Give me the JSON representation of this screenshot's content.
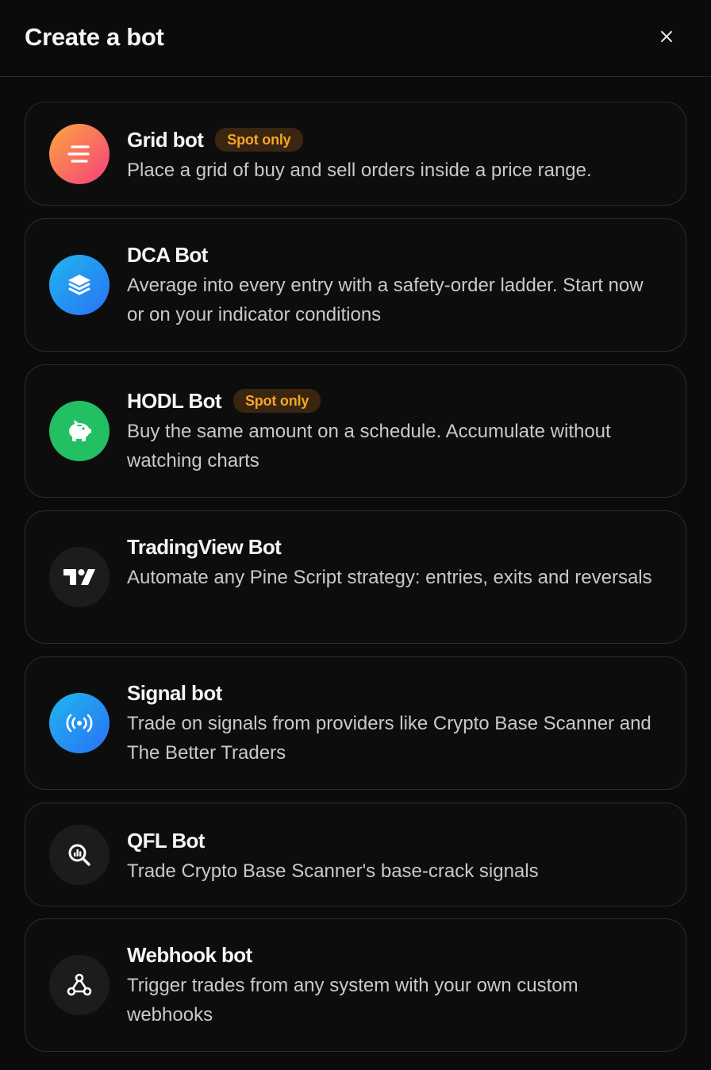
{
  "dialog": {
    "title": "Create a bot",
    "close_icon": "close-icon"
  },
  "bots": [
    {
      "name": "Grid bot",
      "badge": "Spot only",
      "description": "Place a grid of buy and sell orders inside a price range.",
      "icon": "grid-lines-icon",
      "icon_bg": [
        "#ffa63d",
        "#f43f7f"
      ]
    },
    {
      "name": "DCA Bot",
      "badge": "",
      "description": "Average into every entry with a safety-order ladder. Start now or on your indicator conditions",
      "icon": "layers-icon",
      "icon_bg": [
        "#1fb6ee",
        "#2a72f5"
      ]
    },
    {
      "name": "HODL Bot",
      "badge": "Spot only",
      "description": "Buy the same amount on a schedule. Accumulate without watching charts",
      "icon": "piggy-bank-icon",
      "icon_bg": [
        "#23c266",
        "#1fae5a"
      ]
    },
    {
      "name": "TradingView Bot",
      "badge": "",
      "description": "Automate any Pine Script strategy: entries, exits and reversals",
      "icon": "tradingview-logo-icon",
      "icon_bg": [
        "#1c1c1f",
        "#1c1c1f"
      ]
    },
    {
      "name": "Signal bot",
      "badge": "",
      "description": "Trade on signals from providers like Crypto Base Scanner and The Better Traders",
      "icon": "broadcast-signal-icon",
      "icon_bg": [
        "#1fb6ee",
        "#2a72f5"
      ]
    },
    {
      "name": "QFL Bot",
      "badge": "",
      "description": "Trade Crypto Base Scanner's base-crack signals",
      "icon": "chart-search-icon",
      "icon_bg": [
        "#1c1c1f",
        "#1c1c1f"
      ]
    },
    {
      "name": "Webhook bot",
      "badge": "",
      "description": "Trigger trades from any system with your own custom webhooks",
      "icon": "webhook-icon",
      "icon_bg": [
        "#1c1c1f",
        "#1c1c1f"
      ]
    }
  ],
  "colors": {
    "background": "#0b0b0c",
    "card_border": "#2c2c30",
    "badge_bg": "#3a2511",
    "badge_text": "#f5a623"
  }
}
